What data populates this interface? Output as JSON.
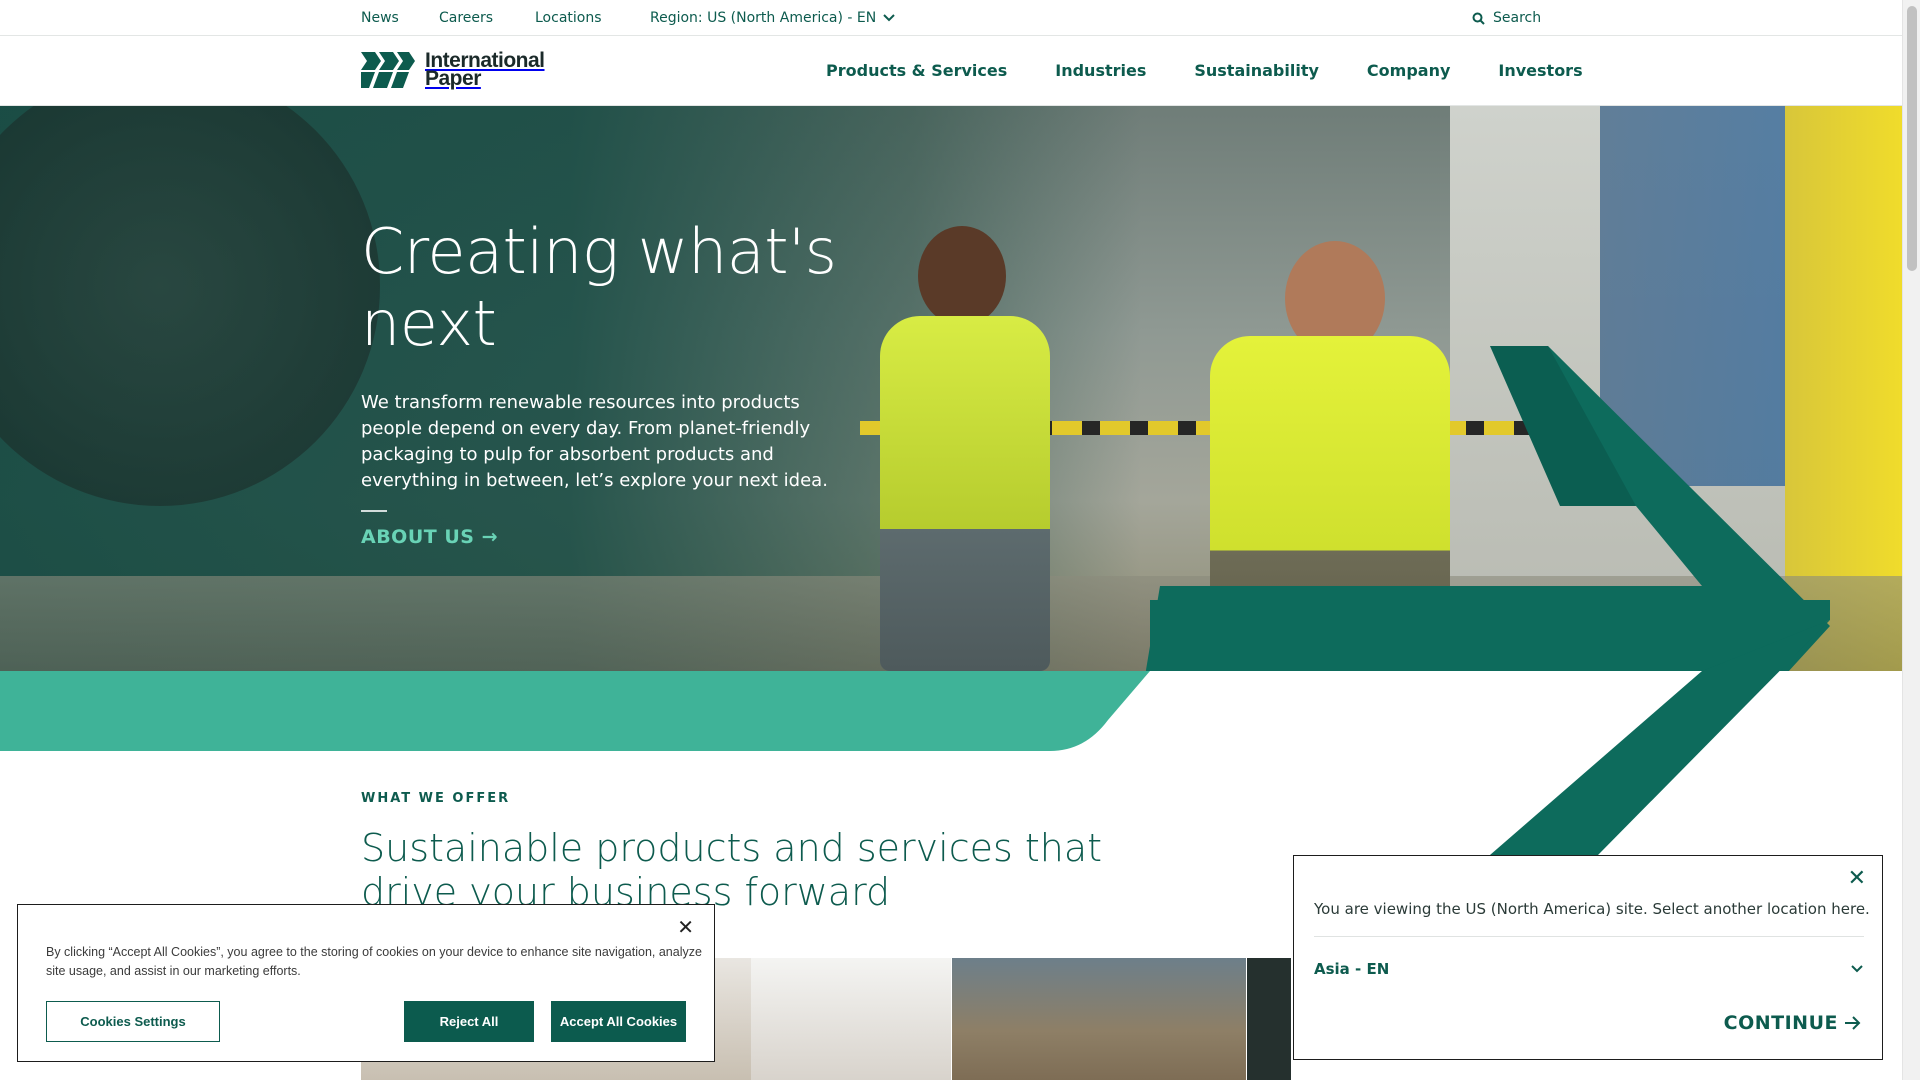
{
  "topbar": {
    "links": [
      "News",
      "Careers",
      "Locations"
    ],
    "region_label": "Region: US (North America) - EN",
    "search_label": "Search"
  },
  "brand": {
    "name_line1": "International",
    "name_line2": "Paper"
  },
  "nav": {
    "items": [
      "Products & Services",
      "Industries",
      "Sustainability",
      "Company",
      "Investors"
    ]
  },
  "hero": {
    "title": "Creating what's next",
    "body": "We transform renewable resources into products people depend on every day. From planet-friendly packaging to pulp for absorbent products and everything in between, let’s explore your next idea.",
    "cta": "ABOUT US →"
  },
  "offer": {
    "eyebrow": "WHAT WE OFFER",
    "title": "Sustainable products and services that drive your business forward"
  },
  "cookie": {
    "text": "By clicking “Accept All Cookies”, you agree to the storing of cookies on your device to enhance site navigation, analyze site usage, and assist in our marketing efforts.",
    "settings": "Cookies Settings",
    "reject": "Reject All",
    "accept": "Accept All Cookies",
    "close": "✕"
  },
  "region_popup": {
    "message": "You are viewing the US (North America) site. Select another location here.",
    "selected": "Asia - EN",
    "continue": "CONTINUE",
    "close": "✕"
  },
  "colors": {
    "brand_green": "#0d5b4e",
    "mint": "#3fb398",
    "accent_link": "#69d3b6"
  }
}
